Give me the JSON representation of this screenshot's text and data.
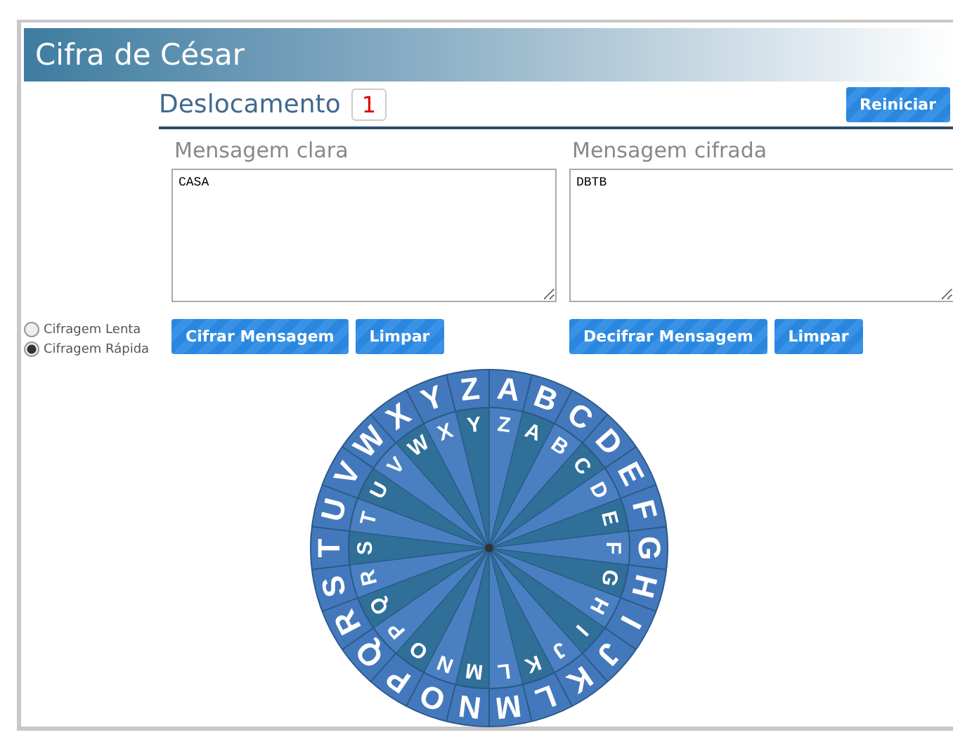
{
  "title": "Cifra de César",
  "shift": {
    "label": "Deslocamento",
    "value": "1"
  },
  "reset_button": "Reiniciar",
  "plain": {
    "label": "Mensagem clara",
    "value": "CASA"
  },
  "cipher": {
    "label": "Mensagem cifrada",
    "value": "DBTB"
  },
  "modes": [
    {
      "label": "Cifragem Lenta",
      "selected": false
    },
    {
      "label": "Cifragem Rápida",
      "selected": true
    }
  ],
  "plain_buttons": [
    "Cifrar Mensagem",
    "Limpar"
  ],
  "cipher_buttons": [
    "Decifrar Mensagem",
    "Limpar"
  ],
  "wheel": {
    "outer_letters": [
      "A",
      "B",
      "C",
      "D",
      "E",
      "F",
      "G",
      "H",
      "I",
      "J",
      "K",
      "L",
      "M",
      "N",
      "O",
      "P",
      "Q",
      "R",
      "S",
      "T",
      "U",
      "V",
      "W",
      "X",
      "Y",
      "Z"
    ],
    "inner_letters": [
      "Z",
      "A",
      "B",
      "C",
      "D",
      "E",
      "F",
      "G",
      "H",
      "I",
      "J",
      "K",
      "L",
      "M",
      "N",
      "O",
      "P",
      "Q",
      "R",
      "S",
      "T",
      "U",
      "V",
      "W",
      "X",
      "Y"
    ]
  }
}
